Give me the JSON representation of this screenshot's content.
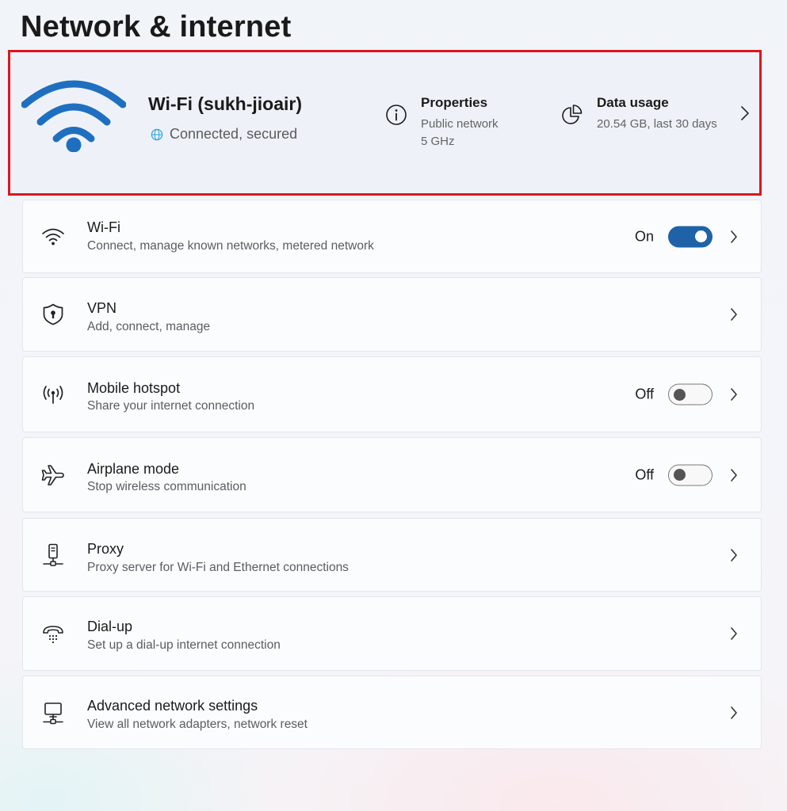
{
  "page": {
    "title": "Network & internet"
  },
  "hero": {
    "network_name": "Wi-Fi (sukh-jioair)",
    "status": "Connected, secured",
    "properties": {
      "title": "Properties",
      "line1": "Public network",
      "line2": "5 GHz"
    },
    "data_usage": {
      "title": "Data usage",
      "value": "20.54 GB, last 30 days"
    },
    "highlight_color": "#d9171f",
    "wifi_icon_color": "#1f6fc0"
  },
  "rows": [
    {
      "icon": "wifi-icon",
      "label": "Wi-Fi",
      "description": "Connect, manage known networks, metered network",
      "state": "On",
      "toggle_on": true
    },
    {
      "icon": "shield-icon",
      "label": "VPN",
      "description": "Add, connect, manage"
    },
    {
      "icon": "hotspot-icon",
      "label": "Mobile hotspot",
      "description": "Share your internet connection",
      "state": "Off",
      "toggle_on": false
    },
    {
      "icon": "airplane-icon",
      "label": "Airplane mode",
      "description": "Stop wireless communication",
      "state": "Off",
      "toggle_on": false
    },
    {
      "icon": "proxy-icon",
      "label": "Proxy",
      "description": "Proxy server for Wi-Fi and Ethernet connections"
    },
    {
      "icon": "dialup-icon",
      "label": "Dial-up",
      "description": "Set up a dial-up internet connection"
    },
    {
      "icon": "network-adapter-icon",
      "label": "Advanced network settings",
      "description": "View all network adapters, network reset"
    }
  ],
  "colors": {
    "accent": "#1f62a7"
  }
}
